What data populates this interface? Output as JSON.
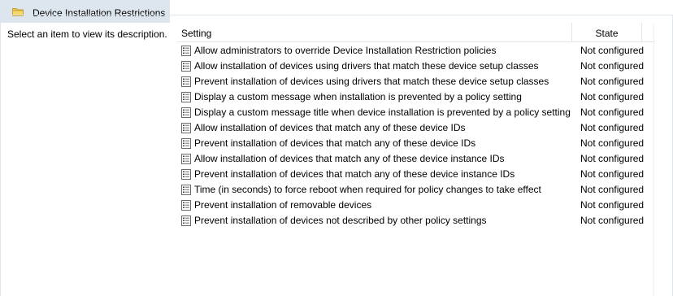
{
  "window": {
    "title": "Device Installation Restrictions",
    "folder_icon": "folder-icon"
  },
  "sidebar": {
    "description": "Select an item to view its description."
  },
  "table": {
    "columns": {
      "setting": "Setting",
      "state": "State"
    },
    "rows": [
      {
        "setting": "Allow administrators to override Device Installation Restriction policies",
        "state": "Not configured"
      },
      {
        "setting": "Allow installation of devices using drivers that match these device setup classes",
        "state": "Not configured"
      },
      {
        "setting": "Prevent installation of devices using drivers that match these device setup classes",
        "state": "Not configured"
      },
      {
        "setting": "Display a custom message when installation is prevented by a policy setting",
        "state": "Not configured"
      },
      {
        "setting": "Display a custom message title when device installation is prevented by a policy setting",
        "state": "Not configured"
      },
      {
        "setting": "Allow installation of devices that match any of these device IDs",
        "state": "Not configured"
      },
      {
        "setting": "Prevent installation of devices that match any of these device IDs",
        "state": "Not configured"
      },
      {
        "setting": "Allow installation of devices that match any of these device instance IDs",
        "state": "Not configured"
      },
      {
        "setting": "Prevent installation of devices that match any of these device instance IDs",
        "state": "Not configured"
      },
      {
        "setting": "Time (in seconds) to force reboot when required for policy changes to take effect",
        "state": "Not configured"
      },
      {
        "setting": "Prevent installation of removable devices",
        "state": "Not configured"
      },
      {
        "setting": "Prevent installation of devices not described by other policy settings",
        "state": "Not configured"
      }
    ]
  },
  "colors": {
    "tab_background": "#dde5ef",
    "folder_yellow": "#f2c84b"
  }
}
